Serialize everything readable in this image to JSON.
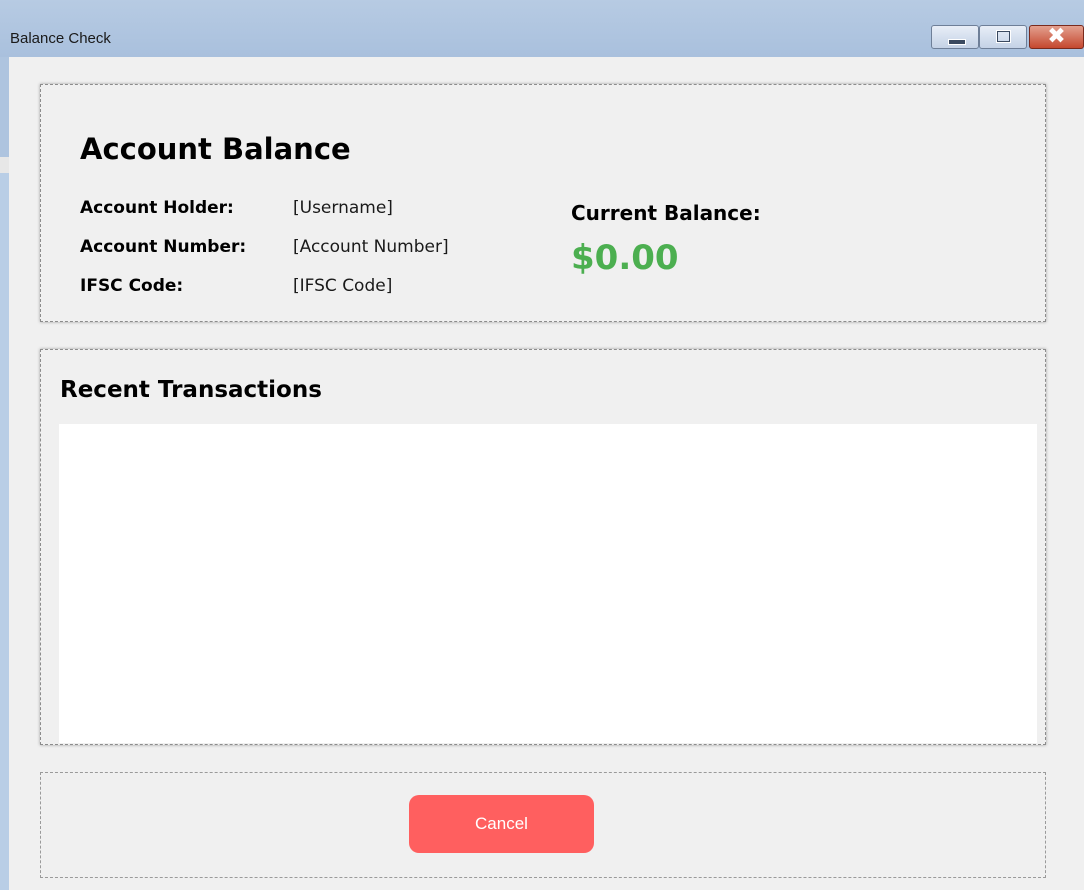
{
  "window": {
    "title": "Balance Check",
    "controls": {
      "minimize_icon": "minimize-icon",
      "maximize_icon": "maximize-icon",
      "close_icon": "close-icon",
      "close_glyph": "✖"
    }
  },
  "account": {
    "heading": "Account Balance",
    "fields": [
      {
        "label": "Account Holder:",
        "value": "[Username]"
      },
      {
        "label": "Account Number:",
        "value": "[Account Number]"
      },
      {
        "label": "IFSC Code:",
        "value": "[IFSC Code]"
      }
    ],
    "current_balance_label": "Current Balance:",
    "current_balance_value": "$0.00",
    "balance_color": "#4caf50"
  },
  "transactions": {
    "heading": "Recent Transactions",
    "items": []
  },
  "footer": {
    "cancel_label": "Cancel",
    "cancel_color": "#ff5f5f"
  }
}
